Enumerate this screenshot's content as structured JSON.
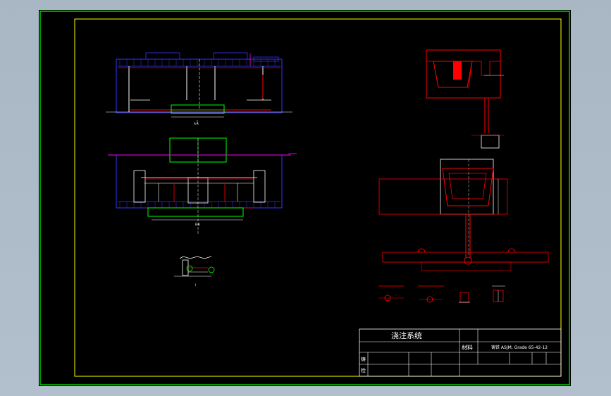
{
  "title_block": {
    "title": "浇注系统",
    "material_label": "材料",
    "material_value": "铸铁 ASJM, Grade 65-42-12",
    "row_label_a": "铸",
    "row_label_b": "检"
  },
  "section_labels": {
    "view_top": "A-A",
    "view_middle": "B-B",
    "view_detail": "I"
  },
  "colors": {
    "background": "#000000",
    "outer_border": "#00ff00",
    "inner_border": "#ffff00",
    "line_blue": "#3333ff",
    "line_red": "#ff0000",
    "line_white": "#ffffff",
    "line_green": "#00ff00",
    "line_magenta": "#ff00ff",
    "line_yellow": "#ffff00",
    "line_cyan": "#00ffff"
  }
}
